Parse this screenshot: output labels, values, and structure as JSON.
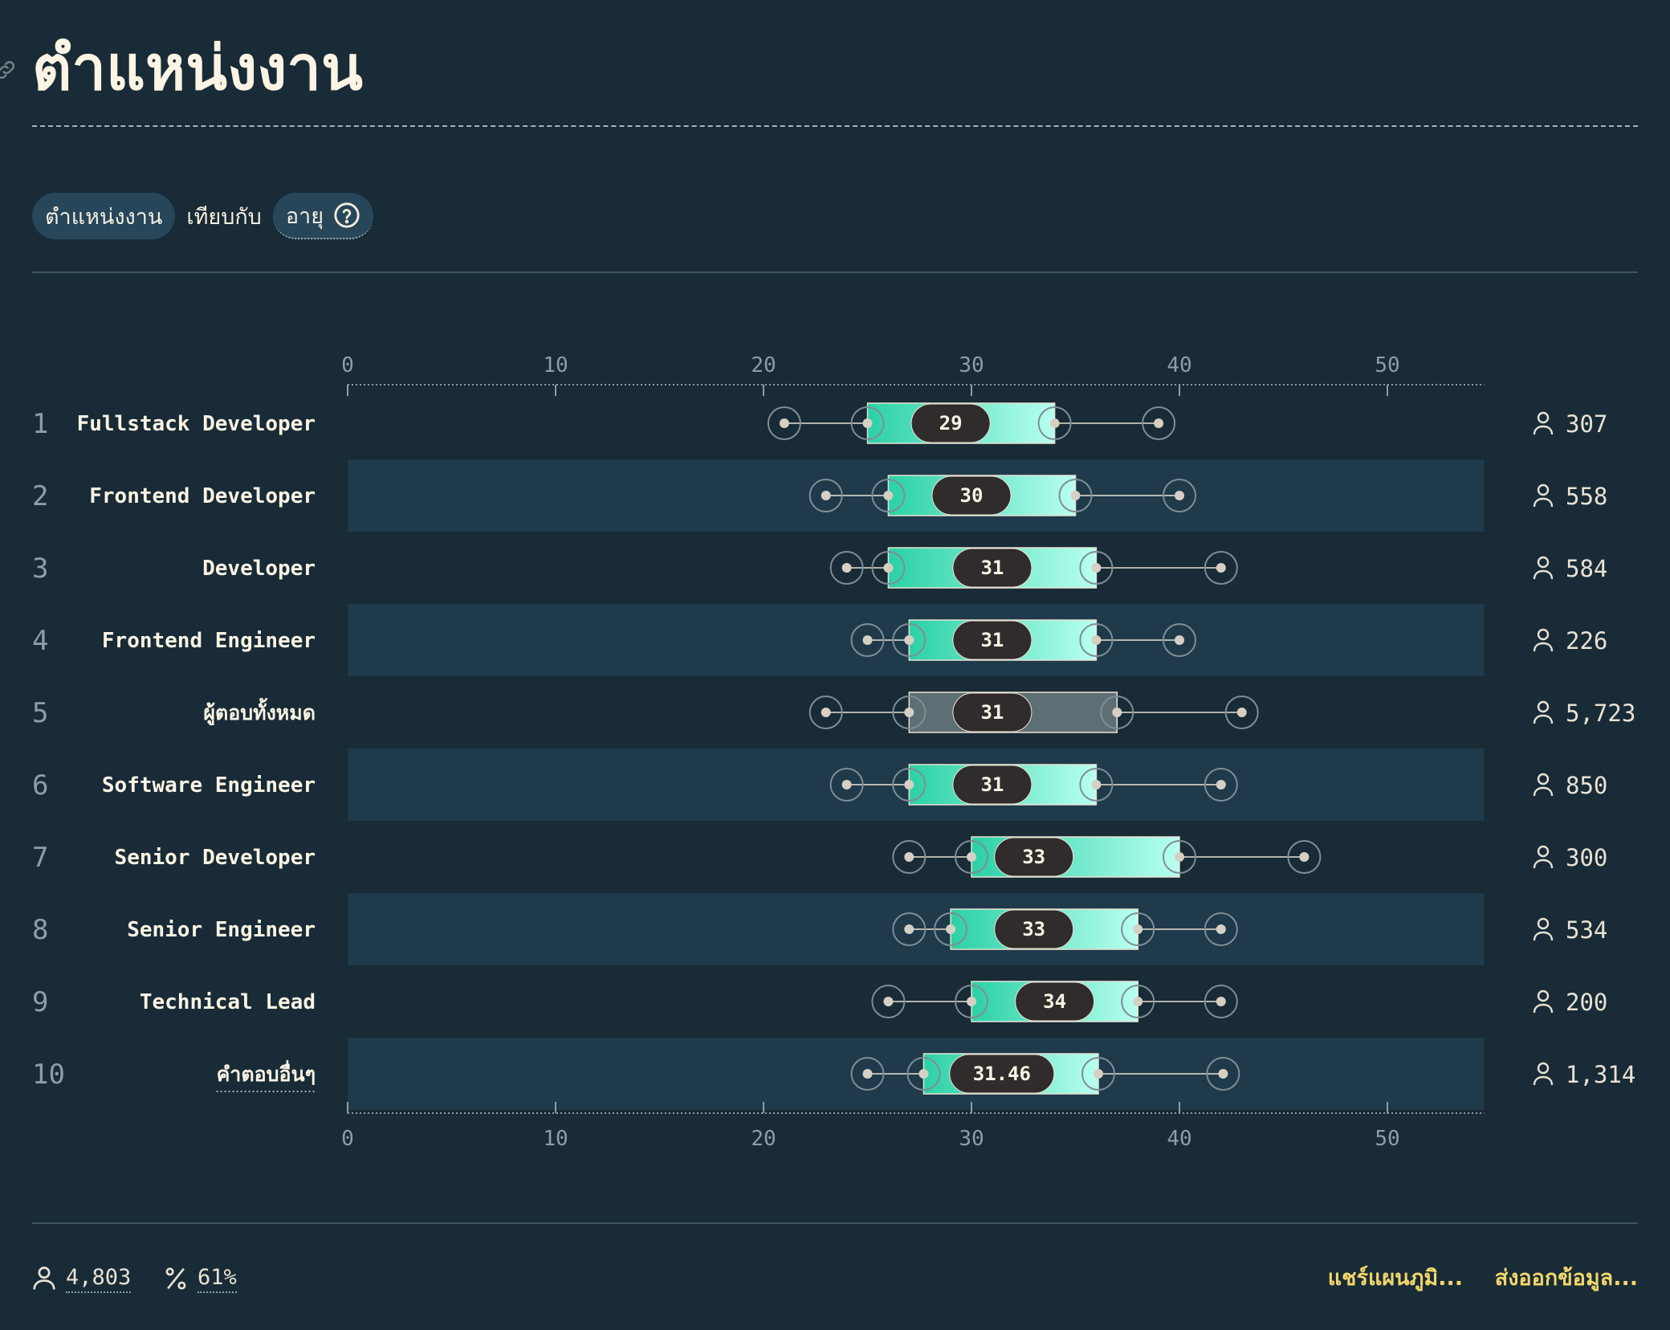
{
  "title": "ตำแหน่งงาน",
  "filter": {
    "primary": "ตำแหน่งงาน",
    "versus": "เทียบกับ",
    "secondary": "อายุ"
  },
  "footer": {
    "respondents": "4,803",
    "percent": "61%",
    "share_label": "แชร์แผนภูมิ...",
    "export_label": "ส่งออกข้อมูล..."
  },
  "colors": {
    "background": "#182b36",
    "row_stripe": "#1f3a4a",
    "box_start": "#2bd1a6",
    "box_end": "#b8fff0",
    "total_box": "#5e6e75",
    "median_pill": "#2f2c2b",
    "footer_link": "#f3d76a"
  },
  "chart_data": {
    "type": "boxplot",
    "orientation": "horizontal",
    "xlim": [
      0,
      55
    ],
    "xticks": [
      0,
      10,
      20,
      30,
      40,
      50
    ],
    "rows": [
      {
        "rank": "1",
        "label": "Fullstack Developer",
        "p10": 21,
        "q1": 25,
        "median": 29,
        "q3": 34,
        "p90": 39,
        "count": "307"
      },
      {
        "rank": "2",
        "label": "Frontend Developer",
        "p10": 23,
        "q1": 26,
        "median": 30,
        "q3": 35,
        "p90": 40,
        "count": "558"
      },
      {
        "rank": "3",
        "label": "Developer",
        "p10": 24,
        "q1": 26,
        "median": 31,
        "q3": 36,
        "p90": 42,
        "count": "584"
      },
      {
        "rank": "4",
        "label": "Frontend Engineer",
        "p10": 25,
        "q1": 27,
        "median": 31,
        "q3": 36,
        "p90": 40,
        "count": "226"
      },
      {
        "rank": "5",
        "label": "ผู้ตอบทั้งหมด",
        "p10": 23,
        "q1": 27,
        "median": 31,
        "q3": 37,
        "p90": 43,
        "count": "5,723",
        "is_total": true
      },
      {
        "rank": "6",
        "label": "Software Engineer",
        "p10": 24,
        "q1": 27,
        "median": 31,
        "q3": 36,
        "p90": 42,
        "count": "850"
      },
      {
        "rank": "7",
        "label": "Senior Developer",
        "p10": 27,
        "q1": 30,
        "median": 33,
        "q3": 40,
        "p90": 46,
        "count": "300"
      },
      {
        "rank": "8",
        "label": "Senior Engineer",
        "p10": 27,
        "q1": 29,
        "median": 33,
        "q3": 38,
        "p90": 42,
        "count": "534"
      },
      {
        "rank": "9",
        "label": "Technical Lead",
        "p10": 26,
        "q1": 30,
        "median": 34,
        "q3": 38,
        "p90": 42,
        "count": "200"
      },
      {
        "rank": "10",
        "label": "คำตอบอื่นๆ",
        "p10": 25,
        "q1": 27.7,
        "median": "31.46",
        "q3": 36.1,
        "p90": 42.1,
        "count": "1,314",
        "is_other": true
      }
    ]
  }
}
